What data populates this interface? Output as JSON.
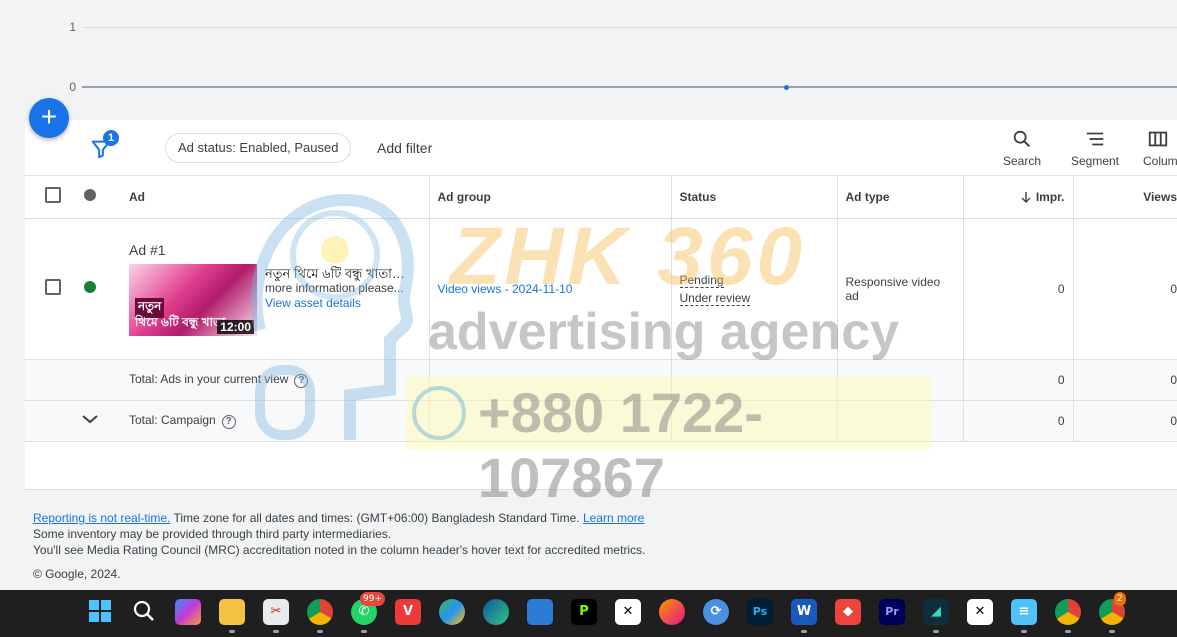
{
  "chart": {
    "y_ticks": [
      "1",
      "0"
    ]
  },
  "fab": {
    "label": "+"
  },
  "toolbar": {
    "filter_count": "1",
    "status_chip": "Ad status: Enabled, Paused",
    "add_filter": "Add filter",
    "search": "Search",
    "segment": "Segment",
    "columns": "Columns"
  },
  "table": {
    "headers": {
      "ad": "Ad",
      "ad_group": "Ad group",
      "status": "Status",
      "ad_type": "Ad type",
      "impr": "Impr.",
      "views": "Views"
    },
    "row": {
      "name": "Ad #1",
      "headline": "নতুন থিমে ৬টি বন্ধু খাতার...",
      "description": "more information please...",
      "view_link": "View asset details",
      "thumb_line1": "নতুন",
      "thumb_line2": "থিমে ৬টি বন্ধু খাতা",
      "duration": "12:00",
      "ad_group": "Video views - 2024-11-10",
      "status_1": "Pending",
      "status_2": "Under review",
      "ad_type": "Responsive video ad",
      "impr": "0",
      "views": "0"
    },
    "total_view": {
      "label": "Total: Ads in your current view",
      "impr": "0",
      "views": "0"
    },
    "total_campaign": {
      "label": "Total: Campaign",
      "impr": "0",
      "views": "0"
    }
  },
  "watermark": {
    "brand": "ZHK 360",
    "agency": "advertising agency",
    "phone": "+880 1722-107867"
  },
  "footer": {
    "reporting_link": "Reporting is not real-time.",
    "timezone": " Time zone for all dates and times: (GMT+06:00) Bangladesh Standard Time. ",
    "learn_more": "Learn more",
    "line2": "Some inventory may be provided through third party intermediaries.",
    "line3": "You'll see Media Rating Council (MRC) accreditation noted in the column header's hover text for accredited metrics.",
    "copyright": "© Google, 2024."
  },
  "taskbar": {
    "whatsapp_badge": "99+",
    "chrome_badge": "2",
    "apps": [
      "start-icon",
      "search-icon",
      "copilot-icon",
      "file-explorer-icon",
      "snipping-icon",
      "chrome-icon",
      "whatsapp-icon",
      "vivaldi-icon",
      "photos-icon",
      "edge-icon",
      "store-icon",
      "pdf-icon",
      "capcut-icon",
      "firefox-icon",
      "sync-icon",
      "photoshop-icon",
      "word-icon",
      "anydesk-icon",
      "premiere-icon",
      "filmora-icon",
      "capcut-icon-2",
      "notepad-icon",
      "chrome-profile-icon",
      "chrome-icon-2"
    ]
  },
  "colors": {
    "accent": "#1a73e8",
    "enabled": "#188038"
  }
}
